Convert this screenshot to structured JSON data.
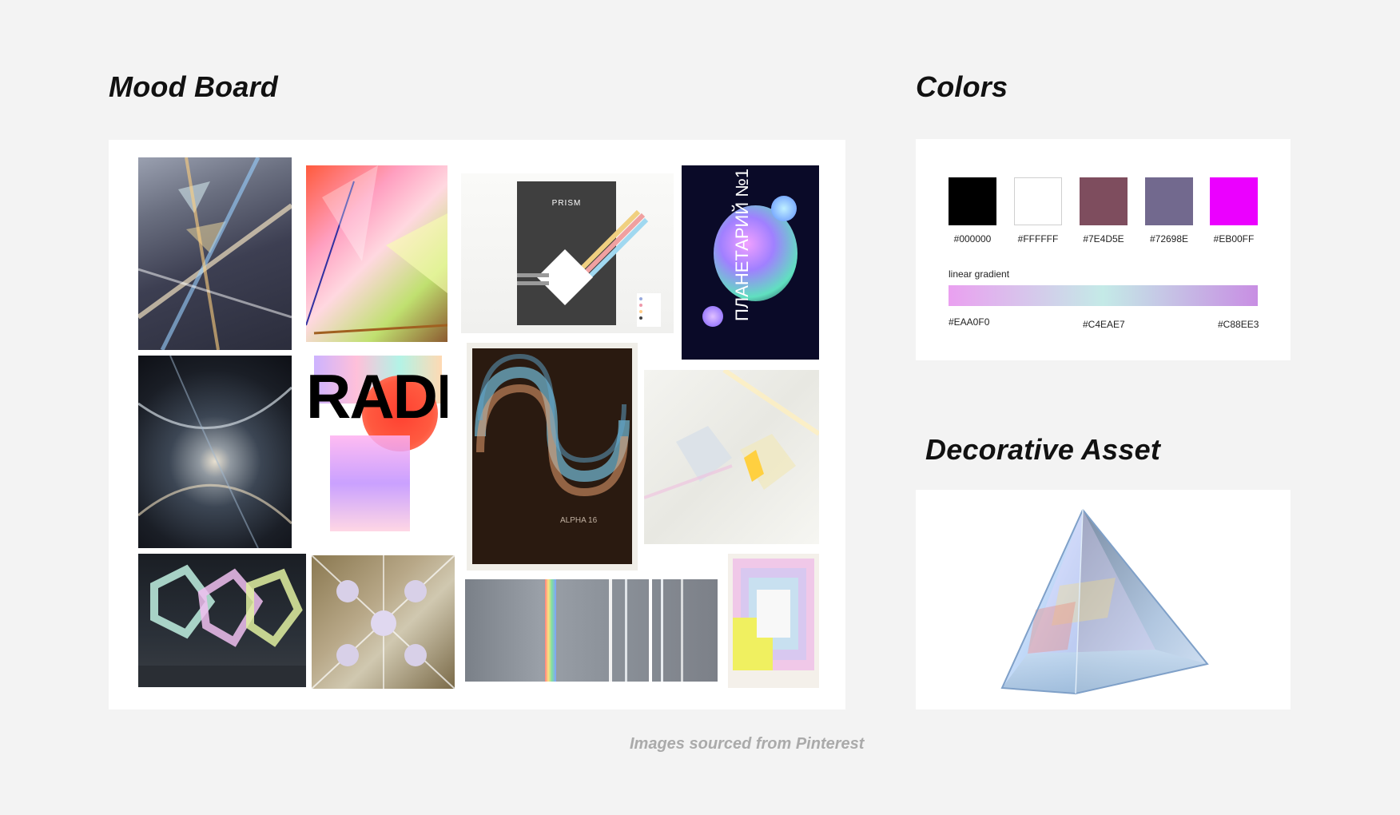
{
  "headings": {
    "mood_board": "Mood Board",
    "colors": "Colors",
    "decorative_asset": "Decorative Asset"
  },
  "colors": {
    "swatches": [
      {
        "hex": "#000000",
        "label": "#000000"
      },
      {
        "hex": "#FFFFFF",
        "label": "#FFFFFF"
      },
      {
        "hex": "#7E4D5E",
        "label": "#7E4D5E"
      },
      {
        "hex": "#72698E",
        "label": "#72698E"
      },
      {
        "hex": "#EB00FF",
        "label": "#EB00FF"
      }
    ],
    "gradient_label": "linear gradient",
    "gradient_stops": [
      {
        "hex": "#EAA0F0",
        "label": "#EAA0F0"
      },
      {
        "hex": "#C4EAE7",
        "label": "#C4EAE7"
      },
      {
        "hex": "#C88EE3",
        "label": "#C88EE3"
      }
    ]
  },
  "moodboard": {
    "images": [
      {
        "name": "prism-light-beams-image"
      },
      {
        "name": "colorful-glass-shards-image"
      },
      {
        "name": "prism-poster-image",
        "title": "PRISM"
      },
      {
        "name": "planetarium-poster-image",
        "title": "ПЛАНЕТАРИЙ №1"
      },
      {
        "name": "light-tunnel-image"
      },
      {
        "name": "radiate-typography-poster-image",
        "title": "RADIATE"
      },
      {
        "name": "alpha-16-poster-image",
        "title": "ALPHA 16"
      },
      {
        "name": "glass-cubes-image"
      },
      {
        "name": "iridescent-sculpture-image"
      },
      {
        "name": "kaleidoscope-flowers-image"
      },
      {
        "name": "rainbow-light-strip-image"
      },
      {
        "name": "pastel-squares-poster-image"
      }
    ]
  },
  "credit": "Images sourced from Pinterest"
}
